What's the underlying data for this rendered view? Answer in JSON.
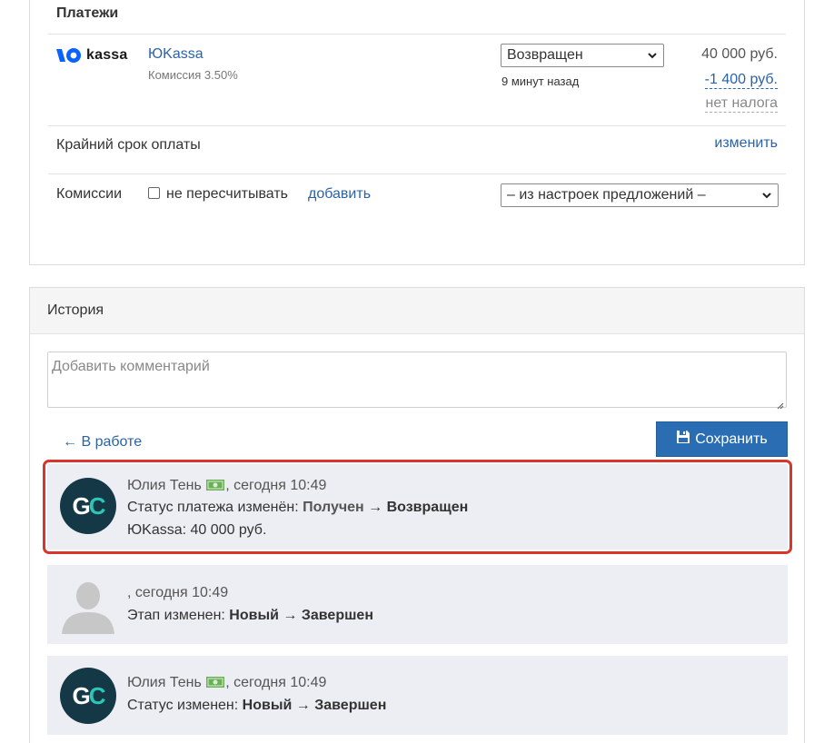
{
  "payments": {
    "title": "Платежи",
    "provider": {
      "logo_text": "kassa",
      "name": "ЮKassa",
      "commission": "Комиссия 3.50%"
    },
    "status_select": {
      "value": "Возвращен"
    },
    "time_ago": "9 минут назад",
    "amount": "40 000 руб.",
    "fee": "-1 400 руб.",
    "tax": "нет налога",
    "deadline": {
      "label": "Крайний срок оплаты",
      "change_link": "изменить"
    },
    "commissions": {
      "label": "Комиссии",
      "checkbox_label": "не пересчитывать",
      "add_link": "добавить",
      "select_value": "– из настроек предложений –"
    }
  },
  "history": {
    "title": "История",
    "comment_placeholder": "Добавить комментарий",
    "back_link": "← В работе",
    "save_button": "Сохранить",
    "entries": [
      {
        "author": "Юлия Тень",
        "time": ", сегодня 10:49",
        "action_prefix": "Статус платежа изменён:",
        "from": "Получен",
        "arrow": "→",
        "to": "Возвращен",
        "detail": "ЮKassa: 40 000 руб."
      },
      {
        "author": "",
        "time": ", сегодня 10:49",
        "action_prefix": "Этап изменен:",
        "from": "Новый",
        "arrow": "→",
        "to": "Завершен"
      },
      {
        "author": "Юлия Тень",
        "time": ", сегодня 10:49",
        "action_prefix": "Статус изменен:",
        "from": "Новый",
        "arrow": "→",
        "to": "Завершен"
      }
    ]
  },
  "avatar_initials": {
    "g": "G",
    "c": "C"
  },
  "colors": {
    "link": "#2a63a8",
    "accent_button": "#2a6db3",
    "highlight": "#d9352a",
    "avatar_bg": "#143846",
    "avatar_c": "#2ec4b6"
  },
  "icons": {
    "money": "money-icon",
    "save": "floppy-icon",
    "chevron": "chevron-down-icon"
  }
}
